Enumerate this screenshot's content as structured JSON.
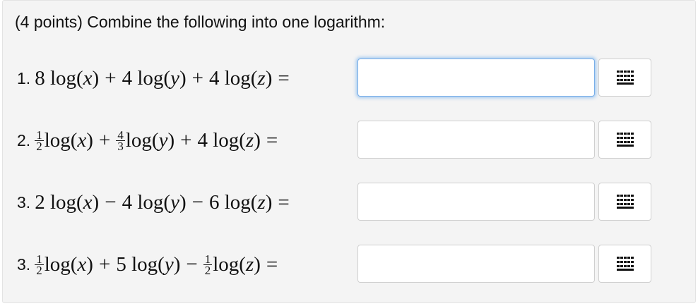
{
  "title": "(4 points) Combine the following into one logarithm:",
  "questions": [
    {
      "num": "1.",
      "t1": {
        "coef": "8"
      },
      "op1": "+",
      "t2": {
        "coef": "4"
      },
      "op2": "+",
      "t3": {
        "coef": "4"
      },
      "eq": "="
    },
    {
      "num": "2.",
      "t1": {
        "fnum": "1",
        "fden": "2"
      },
      "op1": "+",
      "t2": {
        "fnum": "4",
        "fden": "3"
      },
      "op2": "+",
      "t3": {
        "coef": "4"
      },
      "eq": "="
    },
    {
      "num": "3.",
      "t1": {
        "coef": "2"
      },
      "op1": "−",
      "t2": {
        "coef": "4"
      },
      "op2": "−",
      "t3": {
        "coef": "6"
      },
      "eq": "="
    },
    {
      "num": "3.",
      "t1": {
        "fnum": "1",
        "fden": "2"
      },
      "op1": "+",
      "t2": {
        "coef": "5"
      },
      "op2": "−",
      "t3": {
        "fnum": "1",
        "fden": "2"
      },
      "eq": "="
    }
  ],
  "log": "log",
  "vars": {
    "x": "x",
    "y": "y",
    "z": "z"
  },
  "answers": [
    "",
    "",
    "",
    ""
  ],
  "icons": {
    "keyboard": "grid-icon"
  },
  "colors": {
    "focus_border": "#78aee8",
    "panel_bg": "#f4f4f4"
  }
}
